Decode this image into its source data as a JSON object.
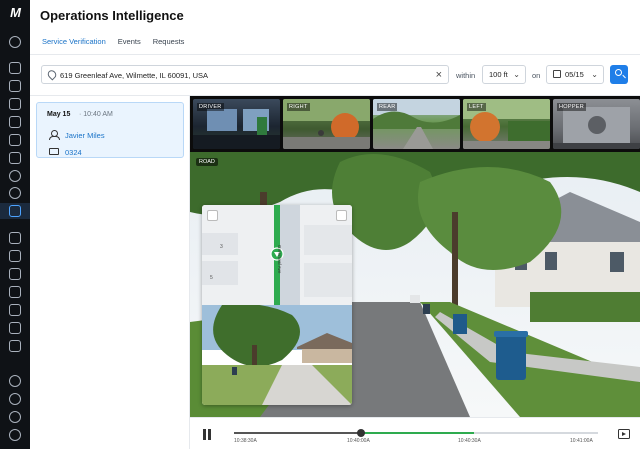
{
  "app": {
    "logo_text": "M",
    "title": "Operations Intelligence"
  },
  "tabs": [
    {
      "label": "Service Verification",
      "active": true
    },
    {
      "label": "Events",
      "active": false
    },
    {
      "label": "Requests",
      "active": false
    }
  ],
  "search": {
    "address_value": "619 Greenleaf Ave, Wilmette, IL 60091, USA",
    "clear_icon": "close-icon",
    "within_label": "within",
    "distance_value": "100 ft",
    "on_label": "on",
    "date_value": "05/15",
    "search_icon": "search-icon"
  },
  "results": [
    {
      "date": "May 15",
      "time": "· 10:40 AM",
      "driver": "Javier Miles",
      "truck": "0324"
    }
  ],
  "cameras": [
    {
      "label": "DRIVER"
    },
    {
      "label": "RIGHT"
    },
    {
      "label": "REAR"
    },
    {
      "label": "LEFT"
    },
    {
      "label": "HOPPER"
    }
  ],
  "road_view": {
    "label": "ROAD"
  },
  "map": {
    "street_name": "Greenleaf Ave",
    "house_numbers": [
      "3",
      "5"
    ]
  },
  "timeline": {
    "ticks": [
      "10:38:30A",
      "10:40:00A",
      "10:40:30A",
      "10:41:00A"
    ],
    "progress_fraction": 0.35,
    "highlight_range_fraction": [
      0.35,
      0.66
    ]
  },
  "colors": {
    "accent": "#1a73c8",
    "rail_bg": "#0f1216",
    "highlight_green": "#2eab4f",
    "card_bg": "#eaf4fe"
  }
}
